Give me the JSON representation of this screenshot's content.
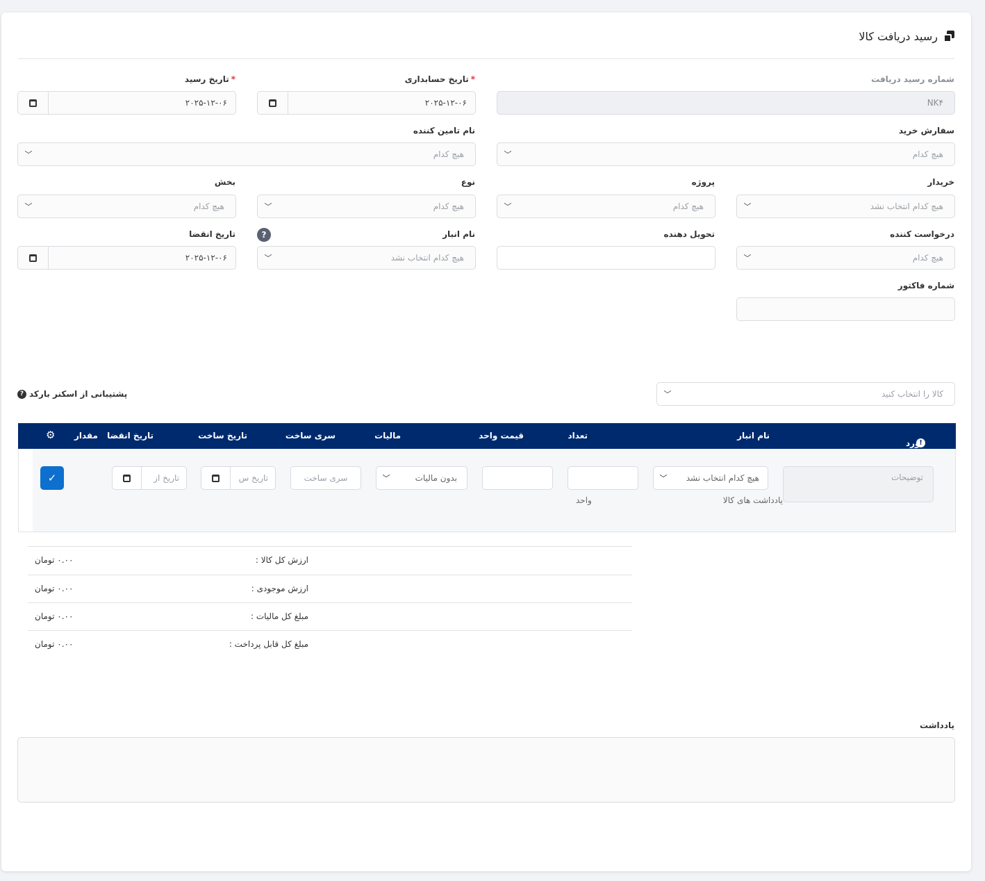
{
  "header": {
    "title": "رسید دریافت کالا"
  },
  "form": {
    "receipt_number": {
      "label": "شماره رسید دریافت",
      "value": "NK۴"
    },
    "accounting_date": {
      "label": "تاریخ حسابداری",
      "required": "*",
      "value": "۲۰۲۵-۱۲-۰۶"
    },
    "receipt_date": {
      "label": "تاریخ رسید",
      "required": "*",
      "value": "۲۰۲۵-۱۲-۰۶"
    },
    "purchase_order": {
      "label": "سفارش خرید",
      "value": "هیچ کدام"
    },
    "supplier": {
      "label": "نام تامین کننده",
      "value": "هیچ کدام"
    },
    "buyer": {
      "label": "خریدار",
      "value": "هیچ کدام انتخاب نشد"
    },
    "project": {
      "label": "پروژه",
      "value": "هیچ کدام"
    },
    "type": {
      "label": "نوع",
      "value": "هیچ کدام"
    },
    "department": {
      "label": "بخش",
      "value": "هیچ کدام"
    },
    "requester": {
      "label": "درخواست کننده",
      "value": "هیچ کدام"
    },
    "deliverer": {
      "label": "تحویل دهنده",
      "value": ""
    },
    "warehouse": {
      "label": "نام انبار",
      "value": "هیچ کدام انتخاب نشد",
      "help": "?"
    },
    "expiry_date": {
      "label": "تاریخ انقضا",
      "value": "۲۰۲۵-۱۲-۰۶"
    },
    "invoice_number": {
      "label": "شماره فاکتور",
      "value": ""
    }
  },
  "item_select": {
    "placeholder": "کالا را انتخاب کنید",
    "barcode_label": "پشتیبانی از اسکنر بارکد",
    "help": "?"
  },
  "table": {
    "headers": {
      "item": "مورد",
      "warehouse": "نام انبار",
      "quantity": "تعداد",
      "unit_price": "قیمت واحد",
      "tax": "مالیات",
      "batch": "سری ساخت",
      "mfg_date": "تاریخ ساخت",
      "expiry": "تاریخ انقضا",
      "amount": "مقدار"
    },
    "row": {
      "description_placeholder": "توضیحات",
      "warehouse_value": "هیچ کدام انتخاب نشد",
      "item_notes": "یادداشت های کالا",
      "unit_label": "واحد",
      "tax_value": "بدون مالیات",
      "batch_placeholder": "سری ساخت",
      "mfg_placeholder": "تاریخ س",
      "expiry_placeholder": "تاریخ از",
      "confirm_icon": "check-icon"
    }
  },
  "summary": [
    {
      "label": "ارزش کل کالا :",
      "value": "۰.۰۰ تومان"
    },
    {
      "label": "ارزش موجودی :",
      "value": "۰.۰۰ تومان"
    },
    {
      "label": "مبلغ کل مالیات :",
      "value": "۰.۰۰ تومان"
    },
    {
      "label": "مبلغ کل قابل پرداخت :",
      "value": "۰.۰۰ تومان"
    }
  ],
  "notes": {
    "label": "یادداشت"
  },
  "colors": {
    "table_header": "#002a6e",
    "confirm": "#0d6fce",
    "required": "#e0393e"
  }
}
